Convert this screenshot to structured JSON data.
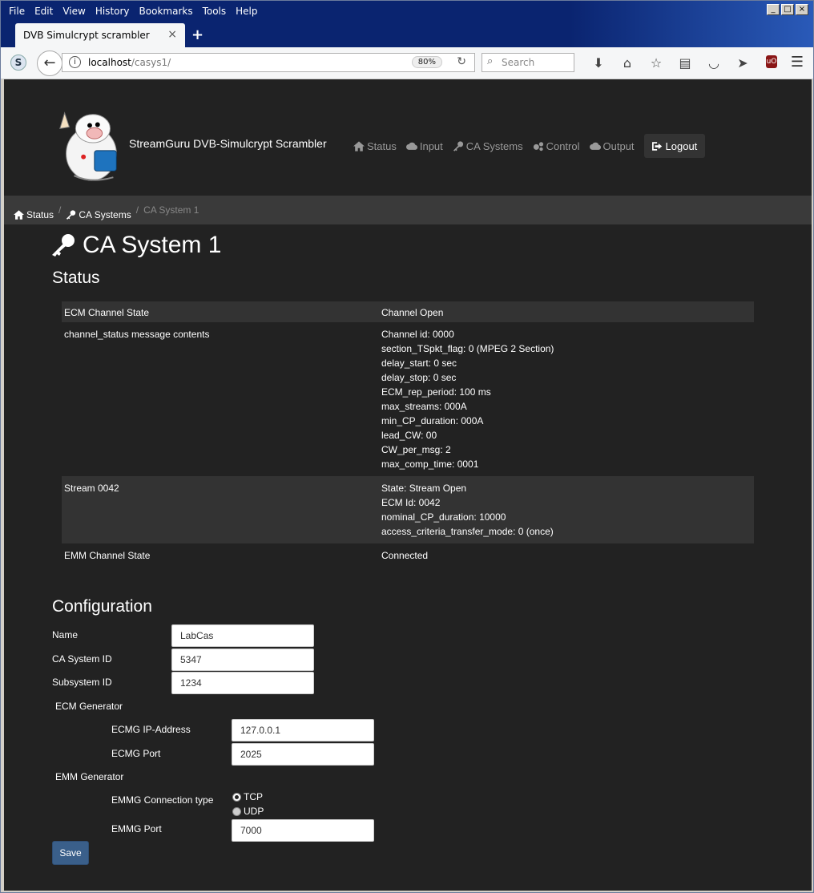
{
  "browser": {
    "menu": [
      "File",
      "Edit",
      "View",
      "History",
      "Bookmarks",
      "Tools",
      "Help"
    ],
    "tab_title": "DVB Simulcrypt scrambler",
    "url_host": "localhost",
    "url_path": "/casys1/",
    "zoom": "80%",
    "search_placeholder": "Search"
  },
  "header": {
    "brand": "StreamGuru DVB-Simulcrypt Scrambler",
    "nav": [
      "Status",
      "Input",
      "CA Systems",
      "Control",
      "Output"
    ],
    "logout": "Logout"
  },
  "breadcrumb": {
    "items": [
      "Status",
      "CA Systems"
    ],
    "current": "CA System 1"
  },
  "page": {
    "title": "CA System 1",
    "status_heading": "Status",
    "config_heading": "Configuration"
  },
  "status": {
    "ecm_channel_state_label": "ECM Channel State",
    "ecm_channel_state_value": "Channel Open",
    "channel_status_label": "channel_status message contents",
    "channel_status_lines": [
      "Channel id: 0000",
      "section_TSpkt_flag: 0 (MPEG 2 Section)",
      "delay_start: 0 sec",
      "delay_stop: 0 sec",
      "ECM_rep_period: 100 ms",
      "max_streams: 000A",
      "min_CP_duration: 000A",
      "lead_CW: 00",
      "CW_per_msg: 2",
      "max_comp_time: 0001"
    ],
    "stream_label": "Stream 0042",
    "stream_lines": [
      "State: Stream Open",
      "ECM Id: 0042",
      "nominal_CP_duration: 10000",
      "access_criteria_transfer_mode: 0 (once)"
    ],
    "emm_channel_state_label": "EMM Channel State",
    "emm_channel_state_value": "Connected"
  },
  "config": {
    "name_label": "Name",
    "name_value": "LabCas",
    "ca_system_id_label": "CA System ID",
    "ca_system_id_value": "5347",
    "subsystem_id_label": "Subsystem ID",
    "subsystem_id_value": "1234",
    "ecm_group": "ECM Generator",
    "ecmg_ip_label": "ECMG IP-Address",
    "ecmg_ip_value": "127.0.0.1",
    "ecmg_port_label": "ECMG Port",
    "ecmg_port_value": "2025",
    "emm_group": "EMM Generator",
    "emmg_conn_label": "EMMG Connection type",
    "emmg_conn_options": [
      "TCP",
      "UDP"
    ],
    "emmg_conn_selected": "TCP",
    "emmg_port_label": "EMMG Port",
    "emmg_port_value": "7000",
    "save_label": "Save"
  }
}
